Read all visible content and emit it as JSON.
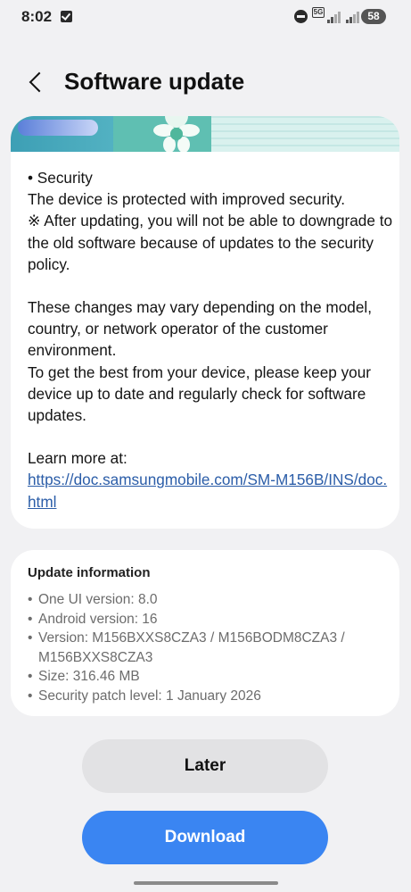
{
  "status_bar": {
    "time": "8:02",
    "network": "5G",
    "battery": "58",
    "icons": [
      "check-box-icon",
      "do-not-disturb-icon",
      "signal-icon",
      "battery-icon"
    ]
  },
  "header": {
    "title": "Software update",
    "back_icon": "back-arrow-icon"
  },
  "release_notes": {
    "security_heading": "• Security",
    "security_line": "The device is protected with improved security.",
    "security_note": "※ After updating, you will not be able to downgrade to the old software because of updates to the security policy.",
    "changes_note": "These changes may vary depending on the model, country, or network operator of the customer environment.",
    "best_note": "To get the best from your device, please keep your device up to date and regularly check for software updates.",
    "learn_more": "Learn more at:",
    "link": "https://doc.samsungmobile.com/SM-M156B/INS/doc.html"
  },
  "update_info": {
    "title": "Update information",
    "items": [
      "One UI version: 8.0",
      "Android version: 16",
      "Version: M156BXXS8CZA3 / M156BODM8CZA3 / M156BXXS8CZA3",
      "Size: 316.46 MB",
      "Security patch level: 1 January 2026"
    ]
  },
  "actions": {
    "later_label": "Later",
    "download_label": "Download"
  },
  "colors": {
    "background": "#f1f1f3",
    "card": "#ffffff",
    "primary": "#3a85f2",
    "secondary_button": "#e2e2e4",
    "link": "#2b5da8"
  }
}
